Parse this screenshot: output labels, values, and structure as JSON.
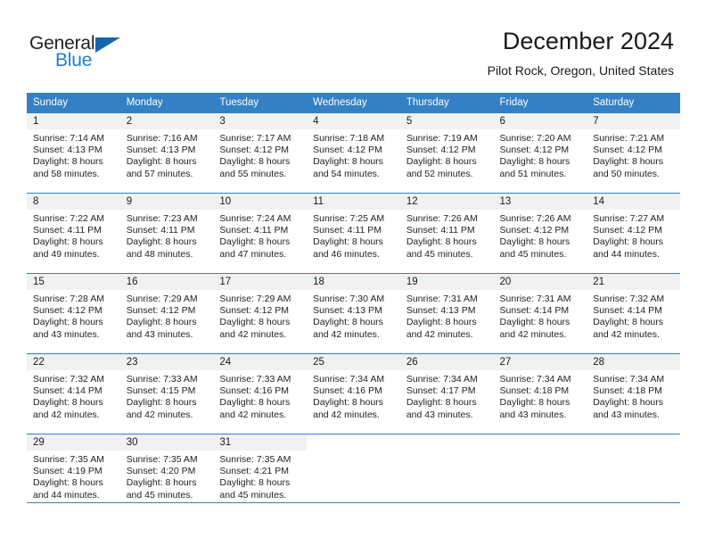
{
  "brand": {
    "name_top": "General",
    "name_bottom": "Blue",
    "triangle_icon": "triangle-icon",
    "color_blue": "#1f7fd0",
    "color_triangle": "#1565b0",
    "color_dark": "#231f20"
  },
  "header": {
    "title": "December 2024",
    "subtitle": "Pilot Rock, Oregon, United States"
  },
  "theme": {
    "header_bg": "#3480c4",
    "header_text": "#ffffff",
    "daynum_band_bg": "#f1f1f1",
    "rule_color": "#3480c4"
  },
  "weekdays": [
    "Sunday",
    "Monday",
    "Tuesday",
    "Wednesday",
    "Thursday",
    "Friday",
    "Saturday"
  ],
  "weeks": [
    [
      {
        "day": "1",
        "sunrise": "Sunrise: 7:14 AM",
        "sunset": "Sunset: 4:13 PM",
        "daylight_1": "Daylight: 8 hours",
        "daylight_2": "and 58 minutes."
      },
      {
        "day": "2",
        "sunrise": "Sunrise: 7:16 AM",
        "sunset": "Sunset: 4:13 PM",
        "daylight_1": "Daylight: 8 hours",
        "daylight_2": "and 57 minutes."
      },
      {
        "day": "3",
        "sunrise": "Sunrise: 7:17 AM",
        "sunset": "Sunset: 4:12 PM",
        "daylight_1": "Daylight: 8 hours",
        "daylight_2": "and 55 minutes."
      },
      {
        "day": "4",
        "sunrise": "Sunrise: 7:18 AM",
        "sunset": "Sunset: 4:12 PM",
        "daylight_1": "Daylight: 8 hours",
        "daylight_2": "and 54 minutes."
      },
      {
        "day": "5",
        "sunrise": "Sunrise: 7:19 AM",
        "sunset": "Sunset: 4:12 PM",
        "daylight_1": "Daylight: 8 hours",
        "daylight_2": "and 52 minutes."
      },
      {
        "day": "6",
        "sunrise": "Sunrise: 7:20 AM",
        "sunset": "Sunset: 4:12 PM",
        "daylight_1": "Daylight: 8 hours",
        "daylight_2": "and 51 minutes."
      },
      {
        "day": "7",
        "sunrise": "Sunrise: 7:21 AM",
        "sunset": "Sunset: 4:12 PM",
        "daylight_1": "Daylight: 8 hours",
        "daylight_2": "and 50 minutes."
      }
    ],
    [
      {
        "day": "8",
        "sunrise": "Sunrise: 7:22 AM",
        "sunset": "Sunset: 4:11 PM",
        "daylight_1": "Daylight: 8 hours",
        "daylight_2": "and 49 minutes."
      },
      {
        "day": "9",
        "sunrise": "Sunrise: 7:23 AM",
        "sunset": "Sunset: 4:11 PM",
        "daylight_1": "Daylight: 8 hours",
        "daylight_2": "and 48 minutes."
      },
      {
        "day": "10",
        "sunrise": "Sunrise: 7:24 AM",
        "sunset": "Sunset: 4:11 PM",
        "daylight_1": "Daylight: 8 hours",
        "daylight_2": "and 47 minutes."
      },
      {
        "day": "11",
        "sunrise": "Sunrise: 7:25 AM",
        "sunset": "Sunset: 4:11 PM",
        "daylight_1": "Daylight: 8 hours",
        "daylight_2": "and 46 minutes."
      },
      {
        "day": "12",
        "sunrise": "Sunrise: 7:26 AM",
        "sunset": "Sunset: 4:11 PM",
        "daylight_1": "Daylight: 8 hours",
        "daylight_2": "and 45 minutes."
      },
      {
        "day": "13",
        "sunrise": "Sunrise: 7:26 AM",
        "sunset": "Sunset: 4:12 PM",
        "daylight_1": "Daylight: 8 hours",
        "daylight_2": "and 45 minutes."
      },
      {
        "day": "14",
        "sunrise": "Sunrise: 7:27 AM",
        "sunset": "Sunset: 4:12 PM",
        "daylight_1": "Daylight: 8 hours",
        "daylight_2": "and 44 minutes."
      }
    ],
    [
      {
        "day": "15",
        "sunrise": "Sunrise: 7:28 AM",
        "sunset": "Sunset: 4:12 PM",
        "daylight_1": "Daylight: 8 hours",
        "daylight_2": "and 43 minutes."
      },
      {
        "day": "16",
        "sunrise": "Sunrise: 7:29 AM",
        "sunset": "Sunset: 4:12 PM",
        "daylight_1": "Daylight: 8 hours",
        "daylight_2": "and 43 minutes."
      },
      {
        "day": "17",
        "sunrise": "Sunrise: 7:29 AM",
        "sunset": "Sunset: 4:12 PM",
        "daylight_1": "Daylight: 8 hours",
        "daylight_2": "and 42 minutes."
      },
      {
        "day": "18",
        "sunrise": "Sunrise: 7:30 AM",
        "sunset": "Sunset: 4:13 PM",
        "daylight_1": "Daylight: 8 hours",
        "daylight_2": "and 42 minutes."
      },
      {
        "day": "19",
        "sunrise": "Sunrise: 7:31 AM",
        "sunset": "Sunset: 4:13 PM",
        "daylight_1": "Daylight: 8 hours",
        "daylight_2": "and 42 minutes."
      },
      {
        "day": "20",
        "sunrise": "Sunrise: 7:31 AM",
        "sunset": "Sunset: 4:14 PM",
        "daylight_1": "Daylight: 8 hours",
        "daylight_2": "and 42 minutes."
      },
      {
        "day": "21",
        "sunrise": "Sunrise: 7:32 AM",
        "sunset": "Sunset: 4:14 PM",
        "daylight_1": "Daylight: 8 hours",
        "daylight_2": "and 42 minutes."
      }
    ],
    [
      {
        "day": "22",
        "sunrise": "Sunrise: 7:32 AM",
        "sunset": "Sunset: 4:14 PM",
        "daylight_1": "Daylight: 8 hours",
        "daylight_2": "and 42 minutes."
      },
      {
        "day": "23",
        "sunrise": "Sunrise: 7:33 AM",
        "sunset": "Sunset: 4:15 PM",
        "daylight_1": "Daylight: 8 hours",
        "daylight_2": "and 42 minutes."
      },
      {
        "day": "24",
        "sunrise": "Sunrise: 7:33 AM",
        "sunset": "Sunset: 4:16 PM",
        "daylight_1": "Daylight: 8 hours",
        "daylight_2": "and 42 minutes."
      },
      {
        "day": "25",
        "sunrise": "Sunrise: 7:34 AM",
        "sunset": "Sunset: 4:16 PM",
        "daylight_1": "Daylight: 8 hours",
        "daylight_2": "and 42 minutes."
      },
      {
        "day": "26",
        "sunrise": "Sunrise: 7:34 AM",
        "sunset": "Sunset: 4:17 PM",
        "daylight_1": "Daylight: 8 hours",
        "daylight_2": "and 43 minutes."
      },
      {
        "day": "27",
        "sunrise": "Sunrise: 7:34 AM",
        "sunset": "Sunset: 4:18 PM",
        "daylight_1": "Daylight: 8 hours",
        "daylight_2": "and 43 minutes."
      },
      {
        "day": "28",
        "sunrise": "Sunrise: 7:34 AM",
        "sunset": "Sunset: 4:18 PM",
        "daylight_1": "Daylight: 8 hours",
        "daylight_2": "and 43 minutes."
      }
    ],
    [
      {
        "day": "29",
        "sunrise": "Sunrise: 7:35 AM",
        "sunset": "Sunset: 4:19 PM",
        "daylight_1": "Daylight: 8 hours",
        "daylight_2": "and 44 minutes."
      },
      {
        "day": "30",
        "sunrise": "Sunrise: 7:35 AM",
        "sunset": "Sunset: 4:20 PM",
        "daylight_1": "Daylight: 8 hours",
        "daylight_2": "and 45 minutes."
      },
      {
        "day": "31",
        "sunrise": "Sunrise: 7:35 AM",
        "sunset": "Sunset: 4:21 PM",
        "daylight_1": "Daylight: 8 hours",
        "daylight_2": "and 45 minutes."
      },
      {
        "day": "",
        "sunrise": "",
        "sunset": "",
        "daylight_1": "",
        "daylight_2": ""
      },
      {
        "day": "",
        "sunrise": "",
        "sunset": "",
        "daylight_1": "",
        "daylight_2": ""
      },
      {
        "day": "",
        "sunrise": "",
        "sunset": "",
        "daylight_1": "",
        "daylight_2": ""
      },
      {
        "day": "",
        "sunrise": "",
        "sunset": "",
        "daylight_1": "",
        "daylight_2": ""
      }
    ]
  ]
}
